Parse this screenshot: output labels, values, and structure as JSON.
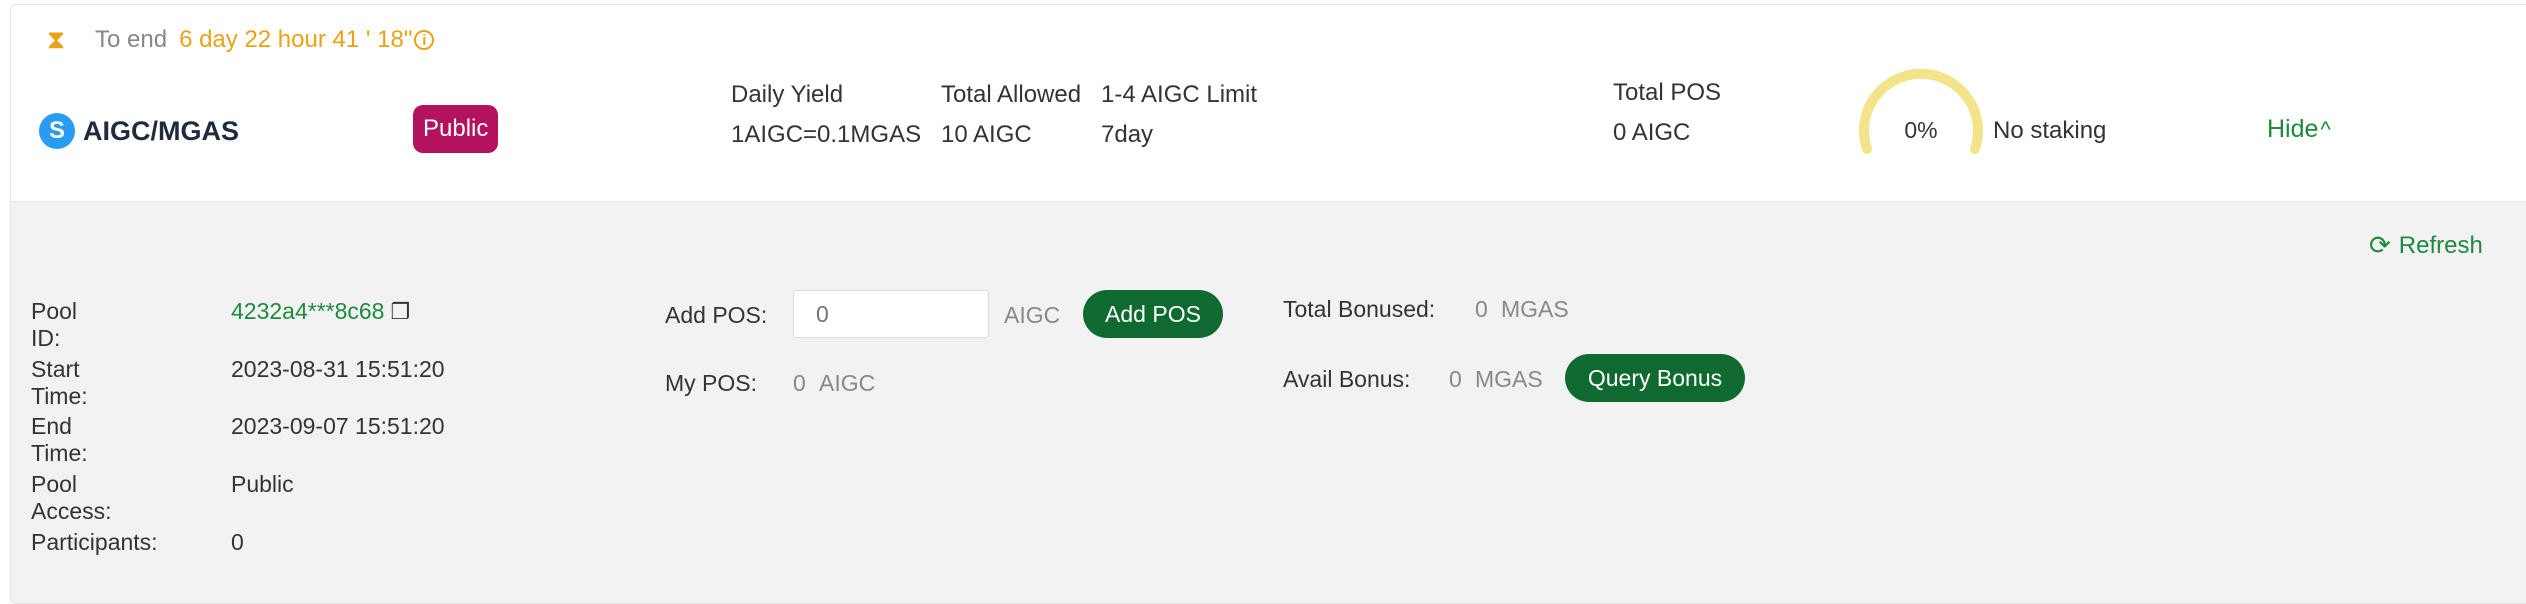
{
  "countdown": {
    "label": "To end",
    "time": "6 day 22 hour 41 ' 18\"",
    "info_glyph": "i"
  },
  "pair": {
    "logo_letter": "S",
    "name": "AIGC/MGAS",
    "badge": "Public"
  },
  "stats": {
    "daily_yield": {
      "label": "Daily Yield",
      "value": "1AIGC=0.1MGAS"
    },
    "total_allowed": {
      "label": "Total Allowed",
      "value": "10 AIGC"
    },
    "limit": {
      "label": "1-4 AIGC Limit",
      "value": "7day"
    },
    "total_pos": {
      "label": "Total POS",
      "value": "0 AIGC"
    }
  },
  "gauge": {
    "percent_label": "0%",
    "percent": 0,
    "color": "#f3e48a"
  },
  "status": "No staking",
  "hide_label": "Hide",
  "hide_chevron": "^",
  "details": {
    "refresh_label": "Refresh",
    "refresh_glyph": "⟳",
    "info": [
      {
        "label": "Pool ID:",
        "value": "4232a4***8c68"
      },
      {
        "label": "Start Time:",
        "value": "2023-08-31 15:51:20"
      },
      {
        "label": "End Time:",
        "value": "2023-09-07 15:51:20"
      },
      {
        "label": "Pool Access:",
        "value": "Public"
      },
      {
        "label": "Participants:",
        "value": "0"
      }
    ],
    "add_pos": {
      "label": "Add POS:",
      "placeholder": "0",
      "unit": "AIGC",
      "button": "Add POS"
    },
    "my_pos": {
      "label": "My POS:",
      "value": "0",
      "unit": "AIGC"
    },
    "total_bonused": {
      "label": "Total Bonused:",
      "value": "0",
      "unit": "MGAS"
    },
    "avail_bonus": {
      "label": "Avail Bonus:",
      "value": "0",
      "unit": "MGAS",
      "button": "Query Bonus"
    }
  },
  "colors": {
    "accent_green": "#1d8a3c",
    "button_green": "#0f6a2f",
    "badge": "#b3125f",
    "countdown": "#e8a317"
  }
}
